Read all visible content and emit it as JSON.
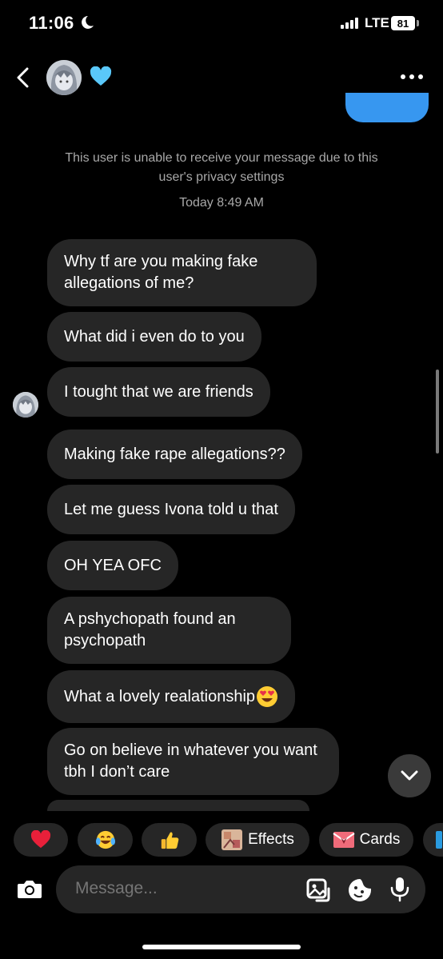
{
  "status_bar": {
    "time": "11:06",
    "network": "LTE",
    "battery": "81"
  },
  "header": {
    "back_icon": "chevron-left-icon",
    "emoji": "blue-heart-icon",
    "more_icon": "more-dots-icon"
  },
  "system_notice": "This user is unable to receive your message due to this user's privacy settings",
  "timestamp": "Today 8:49 AM",
  "messages": [
    "Why tf are you making fake allegations of me?",
    "What did i even do to you",
    "I tought that we are friends",
    "Making fake rape allegations??",
    "Let me guess Ivona told u that",
    "OH YEA OFC",
    "A pshychopath found an psychopath",
    "What a lovely realationship",
    "Go on believe in whatever you want tbh I don’t care"
  ],
  "quick_reactions": {
    "effects_label": "Effects",
    "cards_label": "Cards"
  },
  "composer": {
    "placeholder": "Message..."
  },
  "colors": {
    "background": "#000000",
    "bubble": "#262626",
    "sent": "#3797f0",
    "muted": "#a8a8a8"
  }
}
